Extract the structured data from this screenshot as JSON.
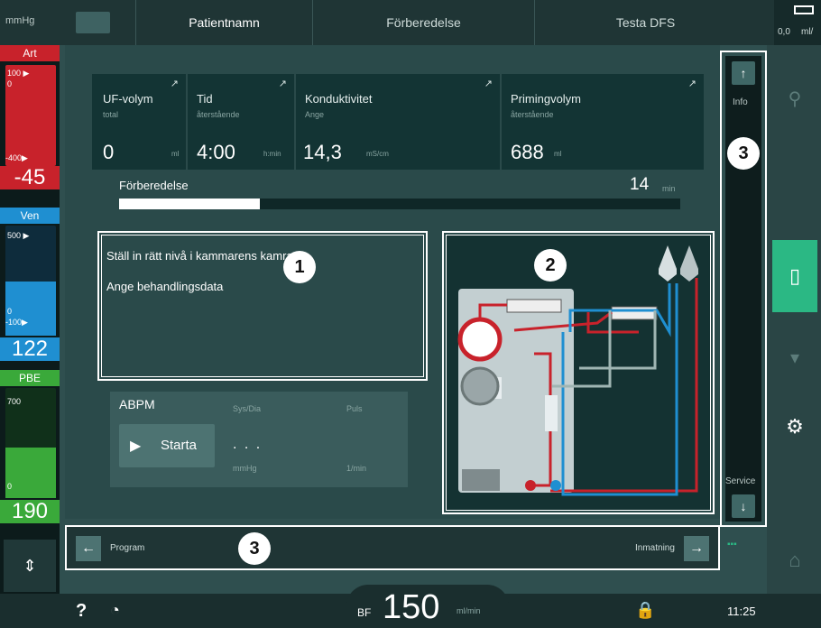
{
  "header": {
    "pressure_unit": "mmHg",
    "tabs": [
      "Patientnamn",
      "Förberedelse",
      "Testa DFS"
    ],
    "right_value": "0,0",
    "right_unit": "ml/"
  },
  "left": {
    "art": {
      "label": "Art",
      "top": "100 ▶",
      "zero": "0",
      "bottom": "-400▶",
      "value": "-45"
    },
    "ven": {
      "label": "Ven",
      "top": "500 ▶",
      "zero": "0",
      "bottom": "-100▶",
      "value": "122"
    },
    "pbe": {
      "label": "PBE",
      "top": "700",
      "zero": "0",
      "value": "190"
    }
  },
  "params": [
    {
      "label": "UF-volym",
      "sub": "total",
      "value": "0",
      "unit": "ml"
    },
    {
      "label": "Tid",
      "sub": "återstående",
      "value": "4:00",
      "unit": "h:min"
    },
    {
      "label": "Konduktivitet",
      "sub": "Ange",
      "value": "14,3",
      "unit": "mS/cm"
    },
    {
      "label": "Primingvolym",
      "sub": "återstående",
      "value": "688",
      "unit": "ml"
    }
  ],
  "progress": {
    "label": "Förberedelse",
    "value": "14",
    "unit": "min",
    "fraction": 0.25
  },
  "messages": [
    "Ställ in rätt nivå i kammarens kamrarna",
    "Ange behandlingsdata"
  ],
  "abpm": {
    "title": "ABPM",
    "start": "Starta",
    "sysdia": "Sys/Dia",
    "puls": "Puls",
    "value": ". . .",
    "unit1": "mmHg",
    "unit2": "1/min"
  },
  "markers": {
    "m1": "1",
    "m2": "2",
    "m3a": "3",
    "m3b": "3"
  },
  "rightcol": {
    "info": "Info",
    "service": "Service"
  },
  "nav": {
    "back": "Program",
    "next": "Inmatning"
  },
  "bottom": {
    "help": "?",
    "bf_label": "BF",
    "bf_value": "150",
    "bf_unit": "ml/min",
    "time": "11:25"
  },
  "colors": {
    "art": "#c8222b",
    "ven": "#1f8fd1",
    "pbe": "#3aa93a",
    "accent": "#2bb884"
  }
}
